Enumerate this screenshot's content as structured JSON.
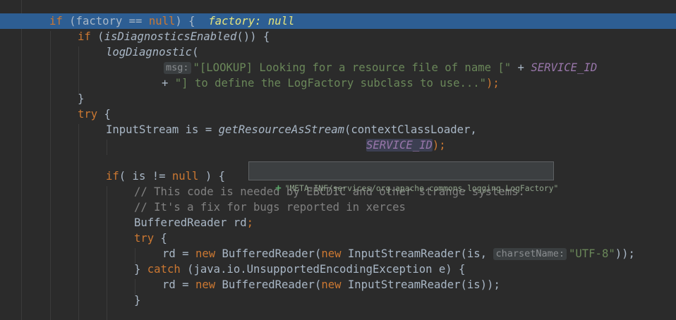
{
  "lines": {
    "l1": {
      "kw_if": "if",
      "rest": " (factory == ",
      "kw_null": "null",
      "close": ") {",
      "inline_value": "factory: null"
    },
    "l2": {
      "kw_if": "if",
      "open": " (",
      "method": "isDiagnosticsEnabled",
      "close": "()) {"
    },
    "l3": {
      "method": "logDiagnostic",
      "open": "("
    },
    "l4": {
      "hint": "msg:",
      "str": "\"[LOOKUP] Looking for a resource file of name [\"",
      "plus": " + ",
      "const": "SERVICE_ID"
    },
    "l5": {
      "plus": "+ ",
      "str": "\"] to define the LogFactory subclass to use...\"",
      "close": ");"
    },
    "l6": {
      "brace": "}"
    },
    "l7": {
      "kw_try": "try",
      "brace": " {"
    },
    "l8": {
      "prefix": "InputStream is = ",
      "method": "getResourceAsStream",
      "args": "(contextClassLoader,"
    },
    "l9": {
      "const": "SERVICE_ID",
      "close": ");"
    },
    "l10": {
      "kw_if": "if",
      "mid1": "( is != ",
      "kw_null": "null",
      "mid2": " ) {"
    },
    "l11": {
      "comment": "// This code is needed by EBCDIC and other strange systems."
    },
    "l12": {
      "comment": "// It's a fix for bugs reported in xerces"
    },
    "l13": {
      "text": "BufferedReader rd;"
    },
    "l14": {
      "kw_try": "try",
      "brace": " {"
    },
    "l15": {
      "p1": "rd = ",
      "kw_new1": "new",
      "p2": " BufferedReader(",
      "kw_new2": "new",
      "p3": " InputStreamReader(is, ",
      "hint": "charsetName:",
      "str": "\"UTF-8\"",
      "close": "));"
    },
    "l16": {
      "open": "} ",
      "kw_catch": "catch",
      "rest": " (java.io.UnsupportedEncodingException e) {"
    },
    "l17": {
      "p1": "rd = ",
      "kw_new1": "new",
      "p2": " BufferedReader(",
      "kw_new2": "new",
      "p3": " InputStreamReader(is));"
    },
    "l18": {
      "brace": "}"
    }
  },
  "tooltip": {
    "icon": "plus-icon",
    "text": "\"META-INF/services/org.apache.commons.logging.LogFactory\""
  },
  "colors": {
    "background": "#2b2b2b",
    "execution_line": "#2d5e93",
    "keyword": "#cc7832",
    "string": "#6a8759",
    "comment": "#808080",
    "constant": "#9876aa",
    "inline_value": "#e6e47c",
    "default_text": "#a9b7c6"
  }
}
